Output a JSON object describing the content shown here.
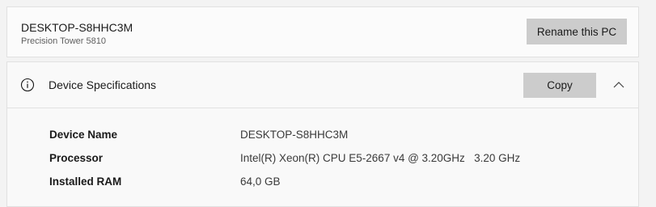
{
  "pc": {
    "name": "DESKTOP-S8HHC3M",
    "model": "Precision Tower 5810",
    "rename_label": "Rename this PC"
  },
  "specs": {
    "title": "Device Specifications",
    "copy_label": "Copy",
    "header_icon": "info-icon",
    "toggle_icon": "chevron-up-icon",
    "rows": [
      {
        "label": "Device Name",
        "value": "DESKTOP-S8HHC3M"
      },
      {
        "label": "Processor",
        "value": "Intel(R) Xeon(R) CPU E5-2667 v4 @ 3.20GHz   3.20 GHz"
      },
      {
        "label": "Installed RAM",
        "value": "64,0 GB"
      }
    ]
  },
  "colors": {
    "background": "#f3f3f3",
    "card": "#fbfbfb",
    "button": "#cccccc",
    "text": "#1a1a1a"
  }
}
